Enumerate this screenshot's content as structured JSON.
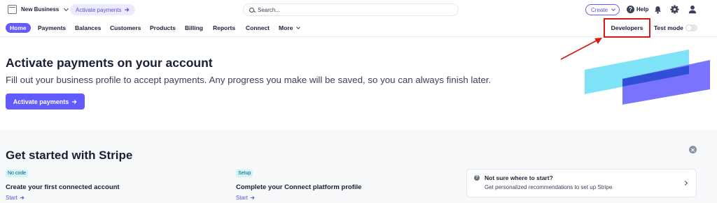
{
  "topbar": {
    "account_name": "New Business",
    "activate_pill_label": "Activate payments",
    "search_placeholder": "Search...",
    "create_label": "Create",
    "help_label": "Help",
    "help_glyph": "?"
  },
  "nav": {
    "items": [
      {
        "label": "Home",
        "active": true
      },
      {
        "label": "Payments"
      },
      {
        "label": "Balances"
      },
      {
        "label": "Customers"
      },
      {
        "label": "Products"
      },
      {
        "label": "Billing"
      },
      {
        "label": "Reports"
      },
      {
        "label": "Connect"
      },
      {
        "label": "More"
      }
    ],
    "developers_label": "Developers",
    "test_mode_label": "Test mode",
    "test_mode_on": false
  },
  "hero": {
    "title": "Activate payments on your account",
    "description": "Fill out your business profile to accept payments. Any progress you make will be saved, so you can always finish later.",
    "button_label": "Activate payments"
  },
  "get_started": {
    "title": "Get started with Stripe",
    "cards": [
      {
        "badge": "No code",
        "title": "Create your first connected account",
        "link": "Start"
      },
      {
        "badge": "Setup",
        "title": "Complete your Connect platform profile",
        "link": "Start"
      }
    ],
    "hint": {
      "title": "Not sure where to start?",
      "subtitle": "Get personalized recommendations to set up Stripe"
    }
  },
  "colors": {
    "brand": "#635bff",
    "annotation": "#d61a1a",
    "art_cyan": "#7fe3f7",
    "art_purple": "#7a73ff",
    "art_blue": "#2e4fd6"
  },
  "icons": [
    "store-icon",
    "chevron-down-icon",
    "arrow-right-icon",
    "search-icon",
    "help-icon",
    "bell-icon",
    "gear-icon",
    "user-icon",
    "toggle-icon",
    "close-icon",
    "info-icon",
    "chevron-right-icon"
  ]
}
